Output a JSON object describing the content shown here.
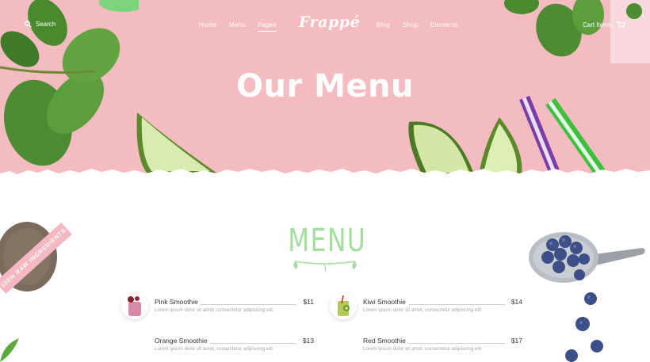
{
  "nav": {
    "search_label": "Search",
    "links": [
      "Home",
      "Menu",
      "Pages",
      "Blog",
      "Shop",
      "Elements"
    ],
    "logo": "Frappé",
    "cart_label": "Cart Items"
  },
  "hero": {
    "title": "Our Menu"
  },
  "menu_section": {
    "heading": "MENU",
    "ribbon_text": "100% RAW INGREDIENTS",
    "items": [
      {
        "name": "Pink Smoothie",
        "price": "$11",
        "desc": "Lorem ipsum dolor sit amet, consectetur adipiscing elit."
      },
      {
        "name": "Kiwi Smoothie",
        "price": "$14",
        "desc": "Lorem ipsum dolor sit amet, consectetur adipiscing elit."
      },
      {
        "name": "Orange Smoothie",
        "price": "$13",
        "desc": "Lorem ipsum dolor sit amet, consectetur adipiscing elit."
      },
      {
        "name": "Red Smoothie",
        "price": "$17",
        "desc": "Lorem ipsum dolor sit amet, consectetur adipiscing elit."
      }
    ]
  },
  "colors": {
    "hero_bg": "#f4bcc0",
    "accent_green": "#a5dca0",
    "ribbon_pink": "#f5b7c2"
  }
}
